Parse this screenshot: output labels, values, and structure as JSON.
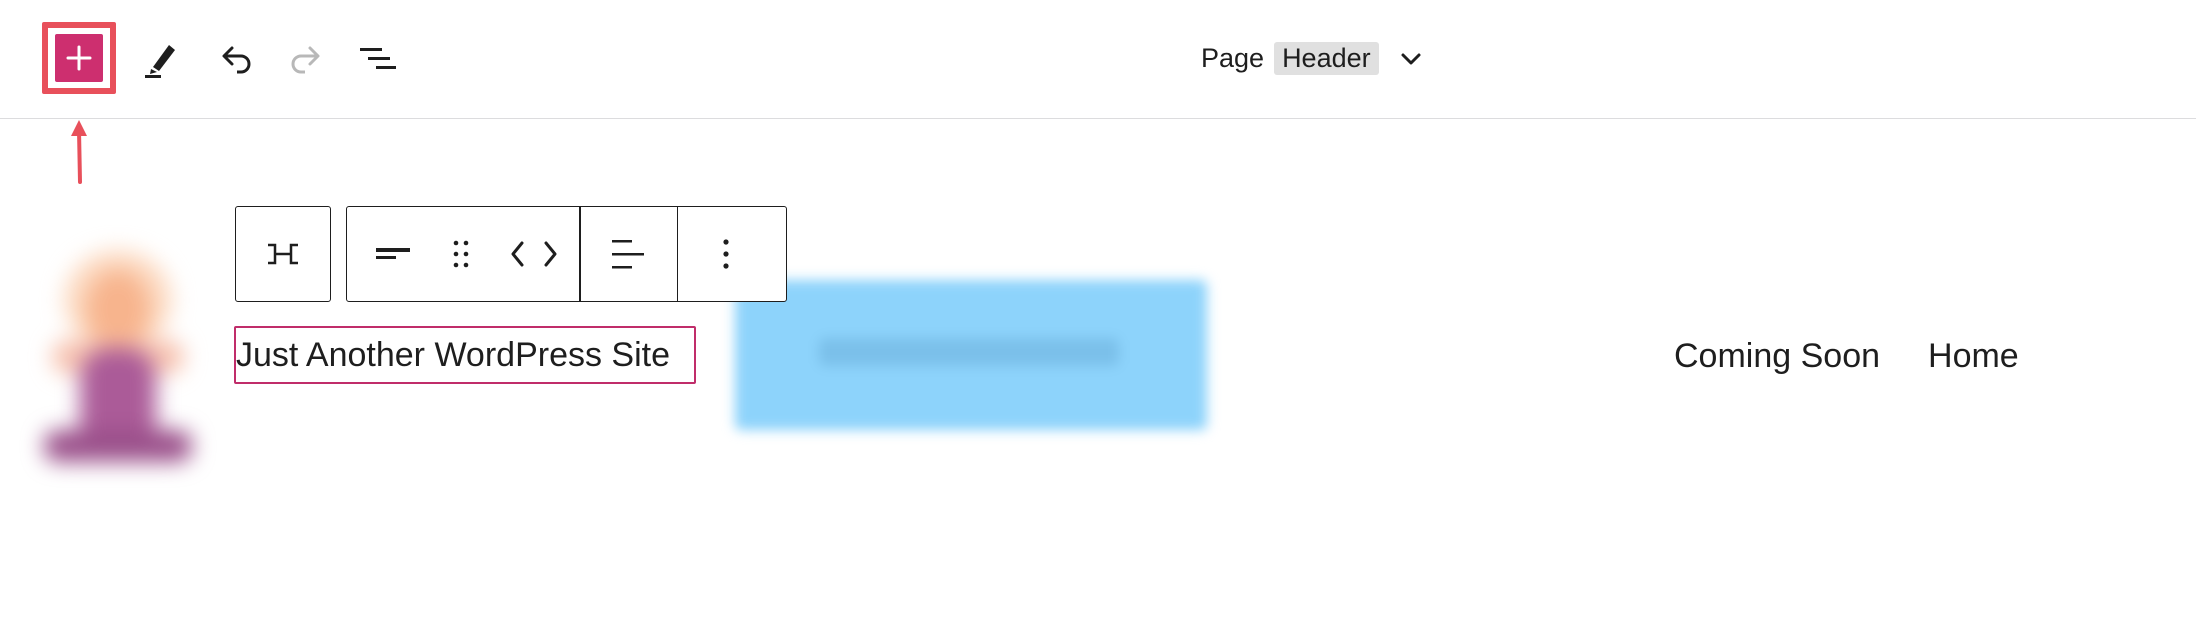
{
  "topbar": {
    "inserter": {
      "icon": "plus-icon",
      "color": "#cd2f6f",
      "highlight_color": "#e8505b"
    },
    "tools": [
      {
        "name": "edit",
        "icon": "pencil-icon"
      },
      {
        "name": "undo",
        "icon": "undo-icon"
      },
      {
        "name": "redo",
        "icon": "redo-icon",
        "disabled": true
      },
      {
        "name": "document-overview",
        "icon": "list-view-icon"
      }
    ],
    "document": {
      "type_label": "Page",
      "title": "Header",
      "chevron_icon": "chevron-down-icon"
    }
  },
  "block_toolbar": {
    "parent_icon": "select-parent-icon",
    "group_icons": [
      "align-justify-left-icon",
      "drag-handle-icon",
      "move-left-right-icon"
    ],
    "align_icon": "align-text-left-icon",
    "options_icon": "more-vertical-icon"
  },
  "header": {
    "site_title": "Just Another WordPress Site",
    "nav_items": [
      "Coming Soon",
      "Home"
    ]
  },
  "colors": {
    "accent": "#cd2f6f",
    "annotation": "#e8505b",
    "blurred_button": "#8dd3fb"
  }
}
